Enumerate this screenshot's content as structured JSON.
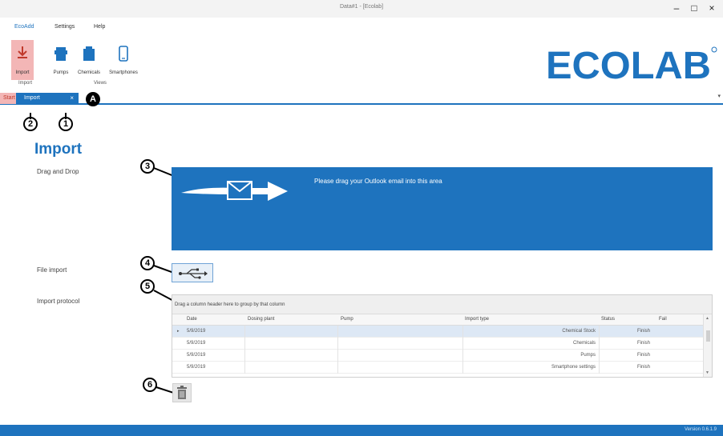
{
  "window": {
    "title": "Data#1 - [Ecolab]",
    "minimize": "–",
    "maximize": "□",
    "close": "×"
  },
  "menu": {
    "items": [
      "EcoAdd",
      "Settings",
      "Help"
    ]
  },
  "ribbon": {
    "buttons": [
      {
        "label": "Import",
        "icon": "import-arrow-icon"
      },
      {
        "label": "Pumps",
        "icon": "pump-icon"
      },
      {
        "label": "Chemicals",
        "icon": "chemical-container-icon"
      },
      {
        "label": "Smartphones",
        "icon": "smartphone-icon"
      }
    ],
    "groups": [
      "Import",
      "Views"
    ]
  },
  "brand": {
    "logo_text": "ECOLAB",
    "color": "#1e73be"
  },
  "tabs": {
    "start": "Start",
    "import": "Import",
    "close_glyph": "×",
    "chevron": "▾"
  },
  "callouts": {
    "c1": "1",
    "c2": "2",
    "c3": "3",
    "c4": "4",
    "c5": "5",
    "c6": "6",
    "ca": "A"
  },
  "page": {
    "title": "Import",
    "labels": {
      "drag_drop": "Drag and Drop",
      "file_import": "File import",
      "protocol": "Import protocol"
    }
  },
  "dropzone": {
    "message": "Please drag your Outlook email into this area"
  },
  "grid": {
    "group_hint": "Drag a column header here to group by that column",
    "columns": [
      "Date",
      "Dosing plant",
      "Pump",
      "Import type",
      "Status",
      "Fail"
    ],
    "rows": [
      {
        "date": "5/9/2019",
        "type": "Chemical Stock",
        "status": "Finish"
      },
      {
        "date": "5/9/2019",
        "type": "Chemicals",
        "status": "Finish"
      },
      {
        "date": "5/9/2019",
        "type": "Pumps",
        "status": "Finish"
      },
      {
        "date": "5/9/2019",
        "type": "Smartphone settings",
        "status": "Finish"
      }
    ],
    "row_indicator": "▸"
  },
  "status": {
    "version": "Version 0.6.1.9"
  },
  "colors": {
    "accent": "#1e73be",
    "active_tab": "#f3b6b6"
  }
}
